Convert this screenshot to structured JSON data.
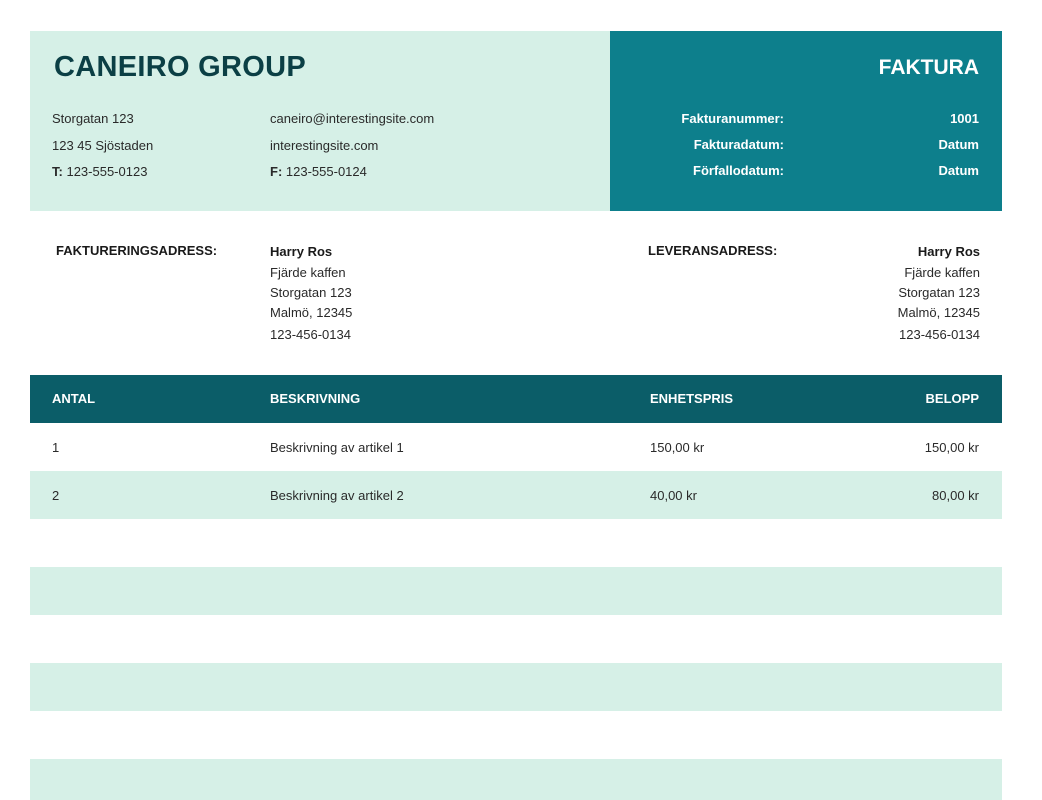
{
  "company": {
    "name": "CANEIRO GROUP",
    "street": "Storgatan 123",
    "postal_city": "123 45 Sjöstaden",
    "phone_prefix": "T:",
    "phone": "123-555-0123",
    "email": "caneiro@interestingsite.com",
    "website": "interestingsite.com",
    "fax_prefix": "F:",
    "fax": "123-555-0124"
  },
  "invoice": {
    "title": "FAKTURA",
    "meta": [
      {
        "label": "Fakturanummer:",
        "value": "1001"
      },
      {
        "label": "Fakturadatum:",
        "value": "Datum"
      },
      {
        "label": "Förfallodatum:",
        "value": "Datum"
      }
    ]
  },
  "billing": {
    "heading": "FAKTURERINGSADRESS:",
    "lines": [
      "Harry Ros",
      "Fjärde kaffen",
      "Storgatan 123",
      "Malmö, 12345",
      "123-456-0134"
    ]
  },
  "shipping": {
    "heading": "LEVERANSADRESS:",
    "lines": [
      "Harry Ros",
      "Fjärde kaffen",
      "Storgatan 123",
      "Malmö, 12345",
      "123-456-0134"
    ]
  },
  "table": {
    "headers": {
      "qty": "ANTAL",
      "desc": "BESKRIVNING",
      "unit": "ENHETSPRIS",
      "amount": "BELOPP"
    },
    "rows": [
      {
        "qty": "1",
        "desc": "Beskrivning av artikel 1",
        "unit": "150,00 kr",
        "amount": "150,00 kr"
      },
      {
        "qty": "2",
        "desc": "Beskrivning av artikel 2",
        "unit": "40,00 kr",
        "amount": "80,00 kr"
      }
    ]
  },
  "colors": {
    "header_light": "#d6f0e7",
    "header_dark": "#0d7f8c",
    "table_header": "#0b5d68",
    "row_shade": "#d6f0e7"
  }
}
